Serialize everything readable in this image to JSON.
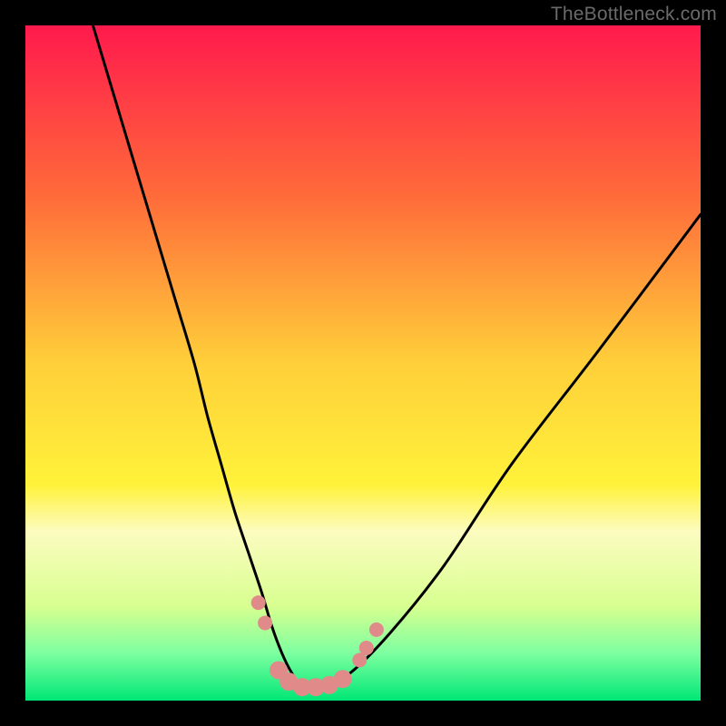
{
  "watermark": "TheBottleneck.com",
  "chart_data": {
    "type": "line",
    "title": "",
    "xlabel": "",
    "ylabel": "",
    "xlim": [
      0,
      100
    ],
    "ylim": [
      0,
      100
    ],
    "gradient_stops": [
      {
        "offset": 0,
        "color": "#ff1a4d"
      },
      {
        "offset": 25,
        "color": "#ff6a3a"
      },
      {
        "offset": 50,
        "color": "#ffcf3a"
      },
      {
        "offset": 68,
        "color": "#fff23a"
      },
      {
        "offset": 75,
        "color": "#fcfcc0"
      },
      {
        "offset": 86,
        "color": "#d8ff90"
      },
      {
        "offset": 93,
        "color": "#7dffa0"
      },
      {
        "offset": 100,
        "color": "#00e776"
      }
    ],
    "series": [
      {
        "name": "bottleneck-curve",
        "x": [
          10,
          13,
          16,
          19,
          22,
          25,
          27,
          29,
          31,
          33,
          35,
          36.5,
          38,
          39.5,
          41,
          44,
          48,
          54,
          62,
          72,
          85,
          100
        ],
        "values": [
          100,
          90,
          80,
          70,
          60,
          50,
          42,
          35,
          28,
          22,
          16,
          11,
          7,
          4,
          2,
          2,
          4,
          10,
          20,
          35,
          52,
          72
        ]
      }
    ],
    "markers": {
      "name": "mismatch-points",
      "color": "#e08a8a",
      "radius_large": 10,
      "radius_small": 8,
      "points": [
        {
          "x": 34.5,
          "y": 14.5,
          "r": "small"
        },
        {
          "x": 35.5,
          "y": 11.5,
          "r": "small"
        },
        {
          "x": 37.5,
          "y": 4.5,
          "r": "large"
        },
        {
          "x": 39,
          "y": 2.8,
          "r": "large"
        },
        {
          "x": 41,
          "y": 2.0,
          "r": "large"
        },
        {
          "x": 43,
          "y": 2.0,
          "r": "large"
        },
        {
          "x": 45,
          "y": 2.3,
          "r": "large"
        },
        {
          "x": 47,
          "y": 3.2,
          "r": "large"
        },
        {
          "x": 49.5,
          "y": 6.0,
          "r": "small"
        },
        {
          "x": 50.5,
          "y": 7.8,
          "r": "small"
        },
        {
          "x": 52,
          "y": 10.5,
          "r": "small"
        }
      ]
    }
  }
}
